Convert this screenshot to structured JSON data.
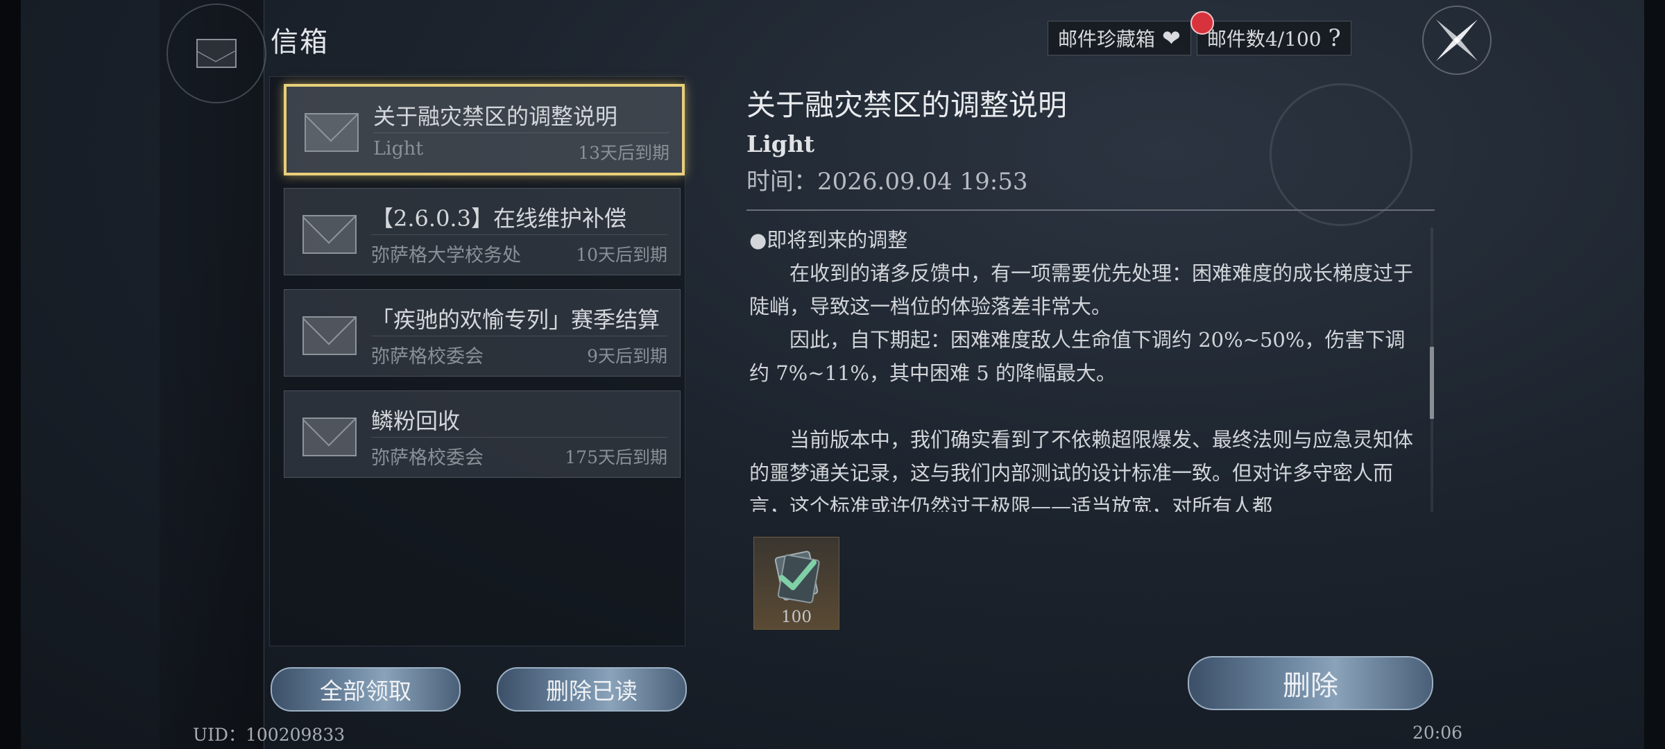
{
  "header": {
    "title": "信箱"
  },
  "topbar": {
    "favorites_label": "邮件珍藏箱",
    "mail_count": "邮件数4/100",
    "help": "?"
  },
  "mails": [
    {
      "subject": "关于融灾禁区的调整说明",
      "sender": "Light",
      "expire": "13天后到期",
      "selected": true
    },
    {
      "subject": "【2.6.0.3】在线维护补偿",
      "sender": "弥萨格大学校务处",
      "expire": "10天后到期"
    },
    {
      "subject": "「疾驰的欢愉专列」赛季结算",
      "sender": "弥萨格校委会",
      "expire": "9天后到期"
    },
    {
      "subject": "鳞粉回收",
      "sender": "弥萨格校委会",
      "expire": "175天后到期"
    }
  ],
  "buttons": {
    "claim_all": "全部领取",
    "delete_read": "删除已读",
    "delete": "删除"
  },
  "detail": {
    "title": "关于融灾禁区的调整说明",
    "sender": "Light",
    "time": "时间：2026.09.04 19:53",
    "body": [
      "●即将到来的调整",
      "在收到的诸多反馈中，有一项需要优先处理：困难难度的成长梯度过于陡峭，导致这一档位的体验落差非常大。",
      "因此，自下期起：困难难度敌人生命值下调约 20%~50%，伤害下调约 7%~11%，其中困难 5 的降幅最大。",
      "当前版本中，我们确实看到了不依赖超限爆发、最终法则与应急灵知体的噩梦通关记录，这与我们内部测试的设计标准一致。但对许多守密人而言，这个标准或许仍然过于极限——适当放宽，对所有人都"
    ],
    "attachment": {
      "quantity": "100",
      "icon": "checkmark-card-icon"
    }
  },
  "footer": {
    "uid": "UID：100209833",
    "clock": "20:06"
  },
  "colors": {
    "selected_border": "#e8cf7a",
    "badge": "#d8323c"
  }
}
